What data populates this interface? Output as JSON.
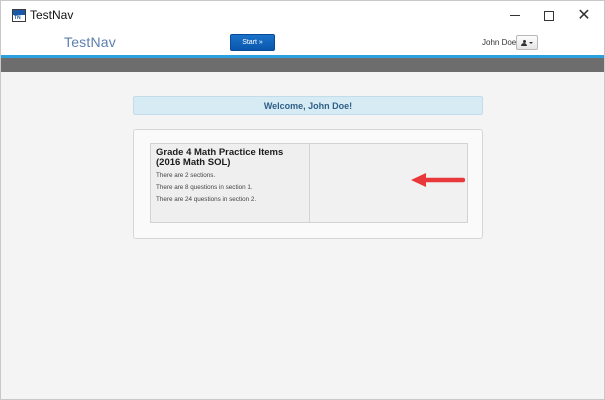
{
  "window": {
    "title": "TestNav",
    "controls": {
      "minimize_icon": "minimize-icon",
      "maximize_icon": "maximize-icon",
      "close_icon": "close-icon"
    }
  },
  "header": {
    "brand": "TestNav",
    "user_name": "John Doe",
    "user_menu_icon": "person-caret-icon",
    "accent_color": "#2aa0de"
  },
  "main": {
    "welcome": "Welcome, John Doe!",
    "test": {
      "title": "Grade 4 Math Practice Items (2016 Math SOL)",
      "info": [
        "There are 2 sections.",
        "There are 8 questions in section 1.",
        "There are 24 questions in section 2."
      ],
      "start_label": "Start »"
    },
    "annotation": {
      "icon": "red-arrow-icon",
      "color": "#e8383b"
    }
  }
}
